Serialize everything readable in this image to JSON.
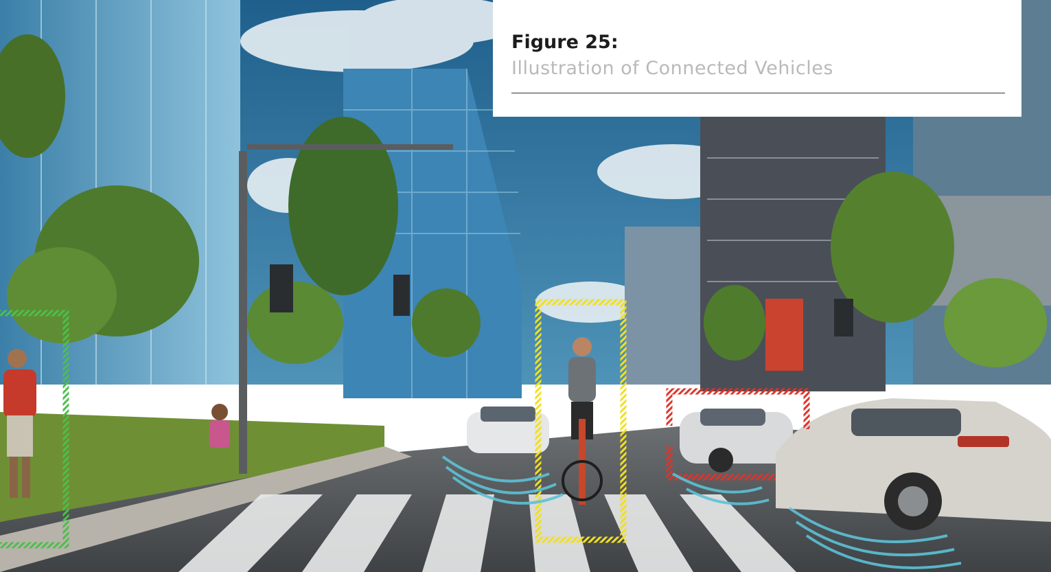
{
  "figure": {
    "label": "Figure 25:",
    "caption": "Illustration of Connected Vehicles"
  },
  "colors": {
    "sky": "#2f6f9a",
    "pedestrian_box": "#4cbf4c",
    "cyclist_box": "#f2e01c",
    "vehicle_box": "#e0332a",
    "signal_waves": "#5cc2d6"
  },
  "detections": [
    {
      "label": "pedestrian",
      "color": "#4cbf4c"
    },
    {
      "label": "cyclist",
      "color": "#f2e01c"
    },
    {
      "label": "vehicle",
      "color": "#e0332a"
    }
  ]
}
